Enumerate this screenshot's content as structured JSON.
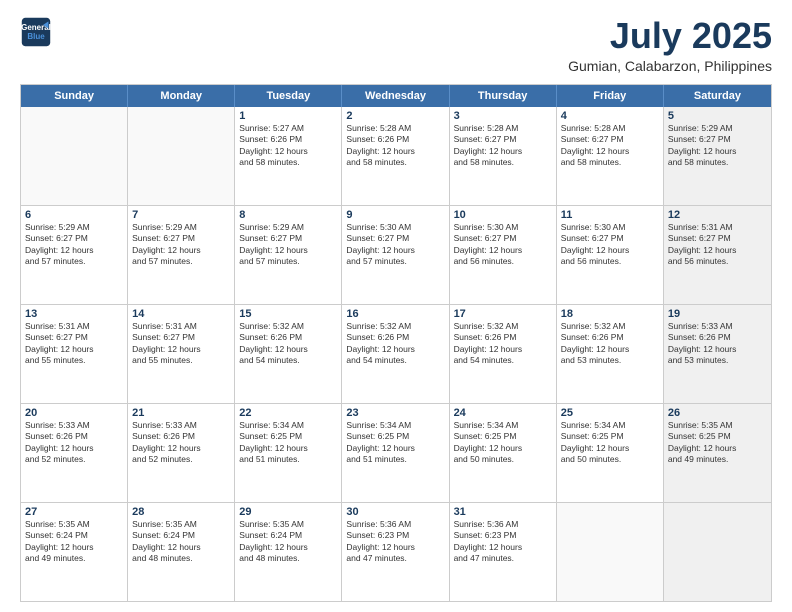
{
  "header": {
    "logo_line1": "General",
    "logo_line2": "Blue",
    "title": "July 2025",
    "subtitle": "Gumian, Calabarzon, Philippines"
  },
  "weekdays": [
    "Sunday",
    "Monday",
    "Tuesday",
    "Wednesday",
    "Thursday",
    "Friday",
    "Saturday"
  ],
  "rows": [
    [
      {
        "day": "",
        "info": "",
        "empty": true
      },
      {
        "day": "",
        "info": "",
        "empty": true
      },
      {
        "day": "1",
        "info": "Sunrise: 5:27 AM\nSunset: 6:26 PM\nDaylight: 12 hours\nand 58 minutes.",
        "shaded": false
      },
      {
        "day": "2",
        "info": "Sunrise: 5:28 AM\nSunset: 6:26 PM\nDaylight: 12 hours\nand 58 minutes.",
        "shaded": false
      },
      {
        "day": "3",
        "info": "Sunrise: 5:28 AM\nSunset: 6:27 PM\nDaylight: 12 hours\nand 58 minutes.",
        "shaded": false
      },
      {
        "day": "4",
        "info": "Sunrise: 5:28 AM\nSunset: 6:27 PM\nDaylight: 12 hours\nand 58 minutes.",
        "shaded": false
      },
      {
        "day": "5",
        "info": "Sunrise: 5:29 AM\nSunset: 6:27 PM\nDaylight: 12 hours\nand 58 minutes.",
        "shaded": true
      }
    ],
    [
      {
        "day": "6",
        "info": "Sunrise: 5:29 AM\nSunset: 6:27 PM\nDaylight: 12 hours\nand 57 minutes.",
        "shaded": false
      },
      {
        "day": "7",
        "info": "Sunrise: 5:29 AM\nSunset: 6:27 PM\nDaylight: 12 hours\nand 57 minutes.",
        "shaded": false
      },
      {
        "day": "8",
        "info": "Sunrise: 5:29 AM\nSunset: 6:27 PM\nDaylight: 12 hours\nand 57 minutes.",
        "shaded": false
      },
      {
        "day": "9",
        "info": "Sunrise: 5:30 AM\nSunset: 6:27 PM\nDaylight: 12 hours\nand 57 minutes.",
        "shaded": false
      },
      {
        "day": "10",
        "info": "Sunrise: 5:30 AM\nSunset: 6:27 PM\nDaylight: 12 hours\nand 56 minutes.",
        "shaded": false
      },
      {
        "day": "11",
        "info": "Sunrise: 5:30 AM\nSunset: 6:27 PM\nDaylight: 12 hours\nand 56 minutes.",
        "shaded": false
      },
      {
        "day": "12",
        "info": "Sunrise: 5:31 AM\nSunset: 6:27 PM\nDaylight: 12 hours\nand 56 minutes.",
        "shaded": true
      }
    ],
    [
      {
        "day": "13",
        "info": "Sunrise: 5:31 AM\nSunset: 6:27 PM\nDaylight: 12 hours\nand 55 minutes.",
        "shaded": false
      },
      {
        "day": "14",
        "info": "Sunrise: 5:31 AM\nSunset: 6:27 PM\nDaylight: 12 hours\nand 55 minutes.",
        "shaded": false
      },
      {
        "day": "15",
        "info": "Sunrise: 5:32 AM\nSunset: 6:26 PM\nDaylight: 12 hours\nand 54 minutes.",
        "shaded": false
      },
      {
        "day": "16",
        "info": "Sunrise: 5:32 AM\nSunset: 6:26 PM\nDaylight: 12 hours\nand 54 minutes.",
        "shaded": false
      },
      {
        "day": "17",
        "info": "Sunrise: 5:32 AM\nSunset: 6:26 PM\nDaylight: 12 hours\nand 54 minutes.",
        "shaded": false
      },
      {
        "day": "18",
        "info": "Sunrise: 5:32 AM\nSunset: 6:26 PM\nDaylight: 12 hours\nand 53 minutes.",
        "shaded": false
      },
      {
        "day": "19",
        "info": "Sunrise: 5:33 AM\nSunset: 6:26 PM\nDaylight: 12 hours\nand 53 minutes.",
        "shaded": true
      }
    ],
    [
      {
        "day": "20",
        "info": "Sunrise: 5:33 AM\nSunset: 6:26 PM\nDaylight: 12 hours\nand 52 minutes.",
        "shaded": false
      },
      {
        "day": "21",
        "info": "Sunrise: 5:33 AM\nSunset: 6:26 PM\nDaylight: 12 hours\nand 52 minutes.",
        "shaded": false
      },
      {
        "day": "22",
        "info": "Sunrise: 5:34 AM\nSunset: 6:25 PM\nDaylight: 12 hours\nand 51 minutes.",
        "shaded": false
      },
      {
        "day": "23",
        "info": "Sunrise: 5:34 AM\nSunset: 6:25 PM\nDaylight: 12 hours\nand 51 minutes.",
        "shaded": false
      },
      {
        "day": "24",
        "info": "Sunrise: 5:34 AM\nSunset: 6:25 PM\nDaylight: 12 hours\nand 50 minutes.",
        "shaded": false
      },
      {
        "day": "25",
        "info": "Sunrise: 5:34 AM\nSunset: 6:25 PM\nDaylight: 12 hours\nand 50 minutes.",
        "shaded": false
      },
      {
        "day": "26",
        "info": "Sunrise: 5:35 AM\nSunset: 6:25 PM\nDaylight: 12 hours\nand 49 minutes.",
        "shaded": true
      }
    ],
    [
      {
        "day": "27",
        "info": "Sunrise: 5:35 AM\nSunset: 6:24 PM\nDaylight: 12 hours\nand 49 minutes.",
        "shaded": false
      },
      {
        "day": "28",
        "info": "Sunrise: 5:35 AM\nSunset: 6:24 PM\nDaylight: 12 hours\nand 48 minutes.",
        "shaded": false
      },
      {
        "day": "29",
        "info": "Sunrise: 5:35 AM\nSunset: 6:24 PM\nDaylight: 12 hours\nand 48 minutes.",
        "shaded": false
      },
      {
        "day": "30",
        "info": "Sunrise: 5:36 AM\nSunset: 6:23 PM\nDaylight: 12 hours\nand 47 minutes.",
        "shaded": false
      },
      {
        "day": "31",
        "info": "Sunrise: 5:36 AM\nSunset: 6:23 PM\nDaylight: 12 hours\nand 47 minutes.",
        "shaded": false
      },
      {
        "day": "",
        "info": "",
        "empty": true
      },
      {
        "day": "",
        "info": "",
        "empty": true,
        "shaded": true
      }
    ]
  ]
}
